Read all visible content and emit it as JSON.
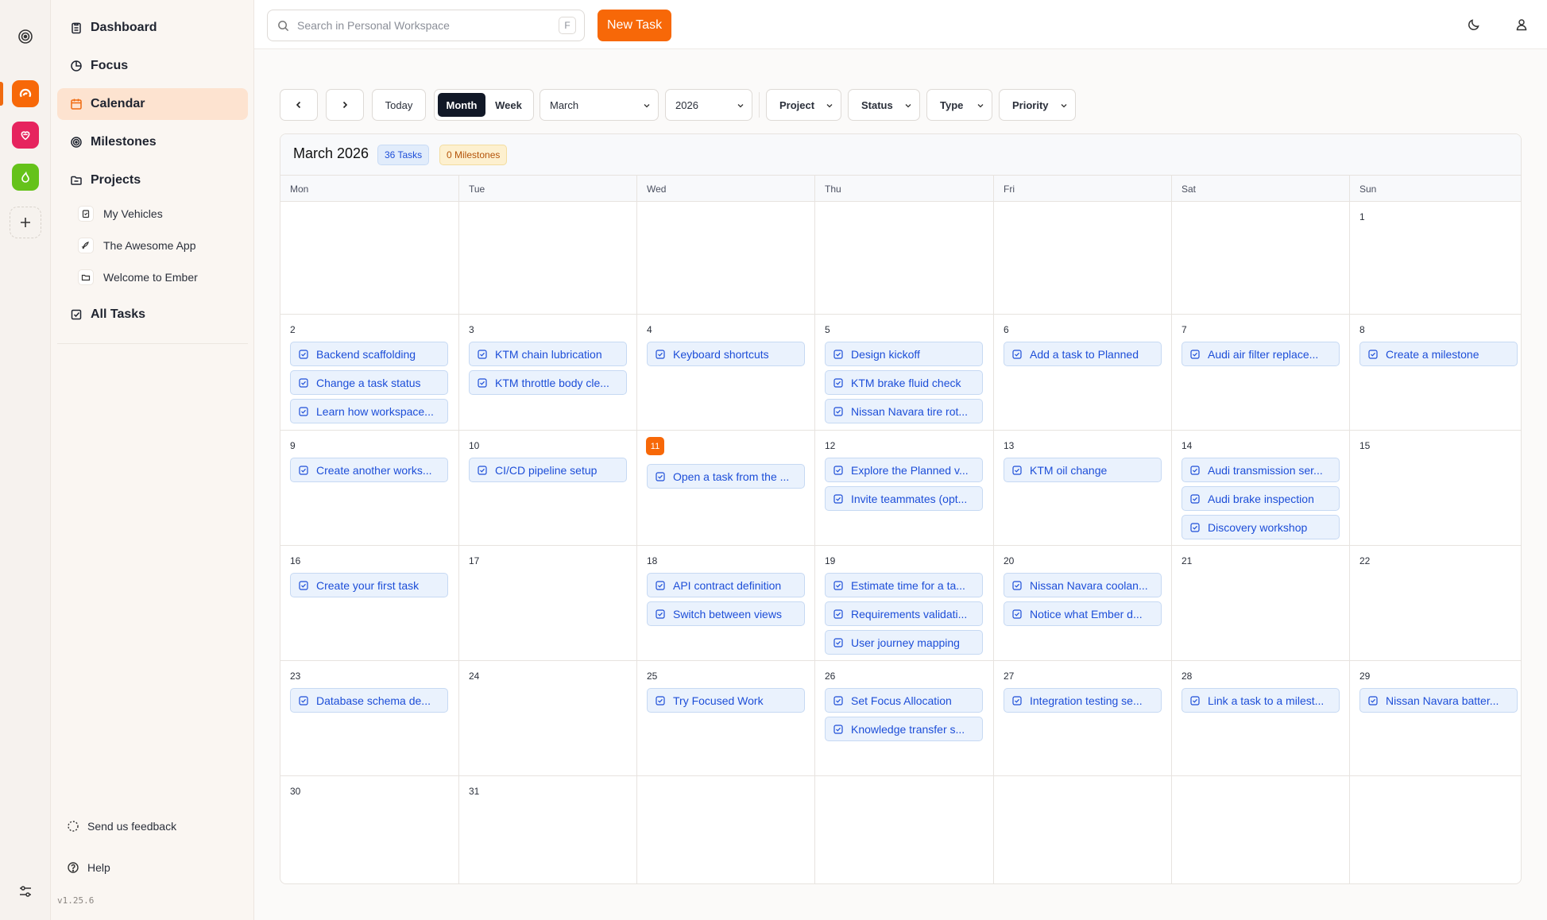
{
  "sidebar": {
    "nav": [
      {
        "label": "Dashboard",
        "icon": "clipboard-icon"
      },
      {
        "label": "Focus",
        "icon": "pie-chart-icon"
      },
      {
        "label": "Calendar",
        "icon": "calendar-icon"
      },
      {
        "label": "Milestones",
        "icon": "target-icon"
      },
      {
        "label": "Projects",
        "icon": "folder-icon"
      }
    ],
    "projects": [
      {
        "label": "My Vehicles",
        "icon": "clipboard-icon"
      },
      {
        "label": "The Awesome App",
        "icon": "rocket-icon"
      },
      {
        "label": "Welcome to Ember",
        "icon": "folder-icon"
      }
    ],
    "all_tasks": "All Tasks",
    "feedback": "Send us feedback",
    "help": "Help",
    "version": "v1.25.6"
  },
  "header": {
    "search_placeholder": "Search in Personal Workspace",
    "search_shortcut": "F",
    "new_task": "New Task"
  },
  "toolbar": {
    "today": "Today",
    "month": "Month",
    "week": "Week",
    "month_select": "March",
    "year_select": "2026",
    "filters": [
      "Project",
      "Status",
      "Type",
      "Priority"
    ]
  },
  "calendar": {
    "title": "March 2026",
    "task_count": "36 Tasks",
    "milestone_count": "0 Milestones",
    "weekdays": [
      "Mon",
      "Tue",
      "Wed",
      "Thu",
      "Fri",
      "Sat",
      "Sun"
    ],
    "today": 11,
    "weeks": [
      [
        null,
        null,
        null,
        null,
        null,
        null,
        {
          "day": "1",
          "tasks": []
        }
      ],
      [
        {
          "day": "2",
          "tasks": [
            "Backend scaffolding",
            "Change a task status",
            "Learn how workspace..."
          ]
        },
        {
          "day": "3",
          "tasks": [
            "KTM chain lubrication",
            "KTM throttle body cle..."
          ]
        },
        {
          "day": "4",
          "tasks": [
            "Keyboard shortcuts"
          ]
        },
        {
          "day": "5",
          "tasks": [
            "Design kickoff",
            "KTM brake fluid check",
            "Nissan Navara tire rot..."
          ]
        },
        {
          "day": "6",
          "tasks": [
            "Add a task to Planned"
          ]
        },
        {
          "day": "7",
          "tasks": [
            "Audi air filter replace..."
          ]
        },
        {
          "day": "8",
          "tasks": [
            "Create a milestone"
          ]
        }
      ],
      [
        {
          "day": "9",
          "tasks": [
            "Create another works..."
          ]
        },
        {
          "day": "10",
          "tasks": [
            "CI/CD pipeline setup"
          ]
        },
        {
          "day": "11",
          "tasks": [
            "Open a task from the ..."
          ]
        },
        {
          "day": "12",
          "tasks": [
            "Explore the Planned v...",
            "Invite teammates (opt..."
          ]
        },
        {
          "day": "13",
          "tasks": [
            "KTM oil change"
          ]
        },
        {
          "day": "14",
          "tasks": [
            "Audi transmission ser...",
            "Audi brake inspection",
            "Discovery workshop"
          ]
        },
        {
          "day": "15",
          "tasks": []
        }
      ],
      [
        {
          "day": "16",
          "tasks": [
            "Create your first task"
          ]
        },
        {
          "day": "17",
          "tasks": []
        },
        {
          "day": "18",
          "tasks": [
            "API contract definition",
            "Switch between views"
          ]
        },
        {
          "day": "19",
          "tasks": [
            "Estimate time for a ta...",
            "Requirements validati...",
            "User journey mapping"
          ]
        },
        {
          "day": "20",
          "tasks": [
            "Nissan Navara coolan...",
            "Notice what Ember d..."
          ]
        },
        {
          "day": "21",
          "tasks": []
        },
        {
          "day": "22",
          "tasks": []
        }
      ],
      [
        {
          "day": "23",
          "tasks": [
            "Database schema de..."
          ]
        },
        {
          "day": "24",
          "tasks": []
        },
        {
          "day": "25",
          "tasks": [
            "Try Focused Work"
          ]
        },
        {
          "day": "26",
          "tasks": [
            "Set Focus Allocation",
            "Knowledge transfer s..."
          ]
        },
        {
          "day": "27",
          "tasks": [
            "Integration testing se..."
          ]
        },
        {
          "day": "28",
          "tasks": [
            "Link a task to a milest..."
          ]
        },
        {
          "day": "29",
          "tasks": [
            "Nissan Navara batter..."
          ]
        }
      ],
      [
        {
          "day": "30",
          "tasks": []
        },
        {
          "day": "31",
          "tasks": []
        },
        null,
        null,
        null,
        null,
        null
      ]
    ]
  },
  "colors": {
    "accent": "#f76808",
    "task_bg": "#eaf2fd",
    "task_text": "#1d4ed8",
    "ws_orange": "#f76808",
    "ws_pink": "#e6245e",
    "ws_green": "#65c21a"
  }
}
